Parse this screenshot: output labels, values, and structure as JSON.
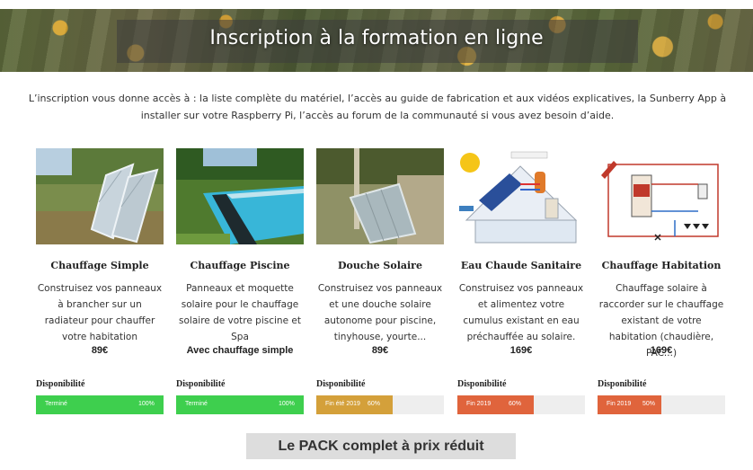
{
  "banner": {
    "title": "Inscription à la formation en ligne"
  },
  "intro": {
    "text": "L’inscription vous donne accès à : la liste complète du matériel, l’accès au guide de fabrication et aux vidéos explicatives, la Sunberry App à installer sur votre Raspberry Pi, l’accès au forum de la communauté si vous avez besoin d’aide."
  },
  "availability_label": "Disponibilité",
  "colors": {
    "complete": "#3ecf4e",
    "in_progress": "#d4a03a",
    "planned": "#e0643c",
    "bar_background": "#eeeeee"
  },
  "products": [
    {
      "title": "Chauffage Simple",
      "description": "Construisez vos panneaux à brancher sur un radiateur pour chauffer votre habitation",
      "price": "89€",
      "extra": "",
      "status": "Terminé",
      "percent_label": "100%",
      "progress": 1.0,
      "color": "#3ecf4e"
    },
    {
      "title": "Chauffage Piscine",
      "description": "Panneaux et moquette solaire pour le chauffage solaire de votre piscine et Spa",
      "price": "",
      "extra": "Avec chauffage simple",
      "status": "Terminé",
      "percent_label": "100%",
      "progress": 1.0,
      "color": "#3ecf4e"
    },
    {
      "title": "Douche Solaire",
      "description": "Construisez vos panneaux et une douche solaire autonome pour piscine, tinyhouse, yourte...",
      "price": "89€",
      "extra": "",
      "status": "Fin été 2019",
      "percent_label": "60%",
      "progress": 0.6,
      "color": "#d4a03a"
    },
    {
      "title": "Eau Chaude Sanitaire",
      "description": "Construisez vos panneaux et alimentez votre cumulus existant en eau préchauffée au solaire.",
      "price": "169€",
      "extra": "",
      "status": "Fin 2019",
      "percent_label": "60%",
      "progress": 0.6,
      "color": "#e0643c"
    },
    {
      "title": "Chauffage Habitation",
      "description": "Chauffage solaire à raccorder sur le chauffage existant de votre habitation (chaudière, PAC...)",
      "price": "169€",
      "extra": "",
      "status": "Fin 2019",
      "percent_label": "50%",
      "progress": 0.5,
      "color": "#e0643c"
    }
  ],
  "pack_button": {
    "label": "Le PACK complet à prix réduit"
  }
}
